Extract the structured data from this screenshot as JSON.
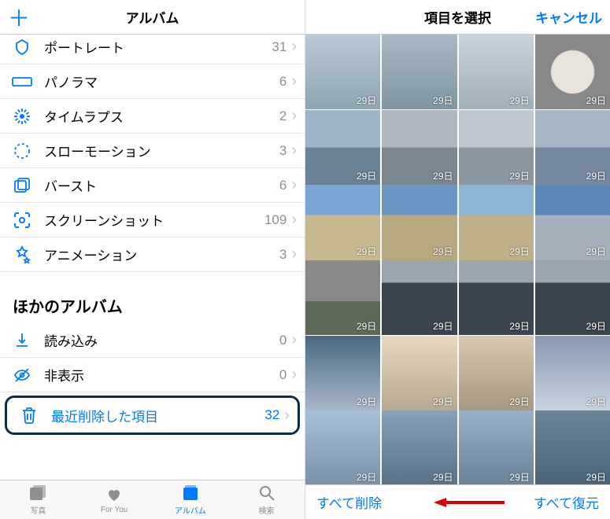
{
  "left": {
    "header_title": "アルバム",
    "items": [
      {
        "label": "ポートレート",
        "count": "31",
        "icon": "portrait"
      },
      {
        "label": "パノラマ",
        "count": "6",
        "icon": "panorama"
      },
      {
        "label": "タイムラプス",
        "count": "2",
        "icon": "timelapse"
      },
      {
        "label": "スローモーション",
        "count": "3",
        "icon": "slomo"
      },
      {
        "label": "バースト",
        "count": "6",
        "icon": "burst"
      },
      {
        "label": "スクリーンショット",
        "count": "109",
        "icon": "screenshot"
      },
      {
        "label": "アニメーション",
        "count": "3",
        "icon": "animation"
      }
    ],
    "section_header": "ほかのアルバム",
    "other_items": [
      {
        "label": "読み込み",
        "count": "0",
        "icon": "import"
      },
      {
        "label": "非表示",
        "count": "0",
        "icon": "hidden"
      },
      {
        "label": "最近削除した項目",
        "count": "32",
        "icon": "trash",
        "highlighted": true
      }
    ],
    "tabs": [
      {
        "label": "写真",
        "icon": "photos"
      },
      {
        "label": "For You",
        "icon": "foryou"
      },
      {
        "label": "アルバム",
        "icon": "albums",
        "active": true
      },
      {
        "label": "検索",
        "icon": "search"
      }
    ]
  },
  "right": {
    "header_title": "項目を選択",
    "cancel": "キャンセル",
    "thumb_label": "29日",
    "thumb_count": 24,
    "delete_all": "すべて削除",
    "restore_all": "すべて復元"
  },
  "thumb_styles": [
    "linear-gradient(#b8c9d4,#8fa5b3)",
    "linear-gradient(#a8b9c4,#7f95a3)",
    "linear-gradient(#c8d4dc,#a0afb8)",
    "radial-gradient(circle at 50% 50%, #e8e4dc 40%, #888 42%)",
    "linear-gradient(#9fb4c4 50%,#6a8294 50%)",
    "linear-gradient(#afb8c0 50%,#7a8690 50%)",
    "linear-gradient(#bfc8d0 50%,#8a96a0 50%)",
    "linear-gradient(#a5b6c4 50%,#7588a0 50%)",
    "linear-gradient(#7aa5d4 40%,#c8b890 40%)",
    "linear-gradient(#6a95c4 40%,#b8a880 40%)",
    "linear-gradient(#8ab5d4 40%,#c0b088 40%)",
    "linear-gradient(#5a88b4 40%,#a5b0bc 40%)",
    "linear-gradient(#888 55%,#5d6a58 55%)",
    "linear-gradient(#9aa5b0 30%,#3a4550 30%)",
    "linear-gradient(#9aa5b0 30%,#3a4550 30%)",
    "linear-gradient(#9aa5b0 30%,#3a4550 30%)",
    "linear-gradient(#4a6880,#a8b8c8)",
    "linear-gradient(#e8d8c0,#b8a890)",
    "linear-gradient(#d8c8b0,#a89880)",
    "linear-gradient(#8898b0,#c8d4e0)",
    "linear-gradient(#a8c0d8,#7890a8)",
    "linear-gradient(#88a0b8,#5a7288)",
    "linear-gradient(#98b0c8,#6a8298)",
    "linear-gradient(#6a8498,#4a6478)"
  ]
}
